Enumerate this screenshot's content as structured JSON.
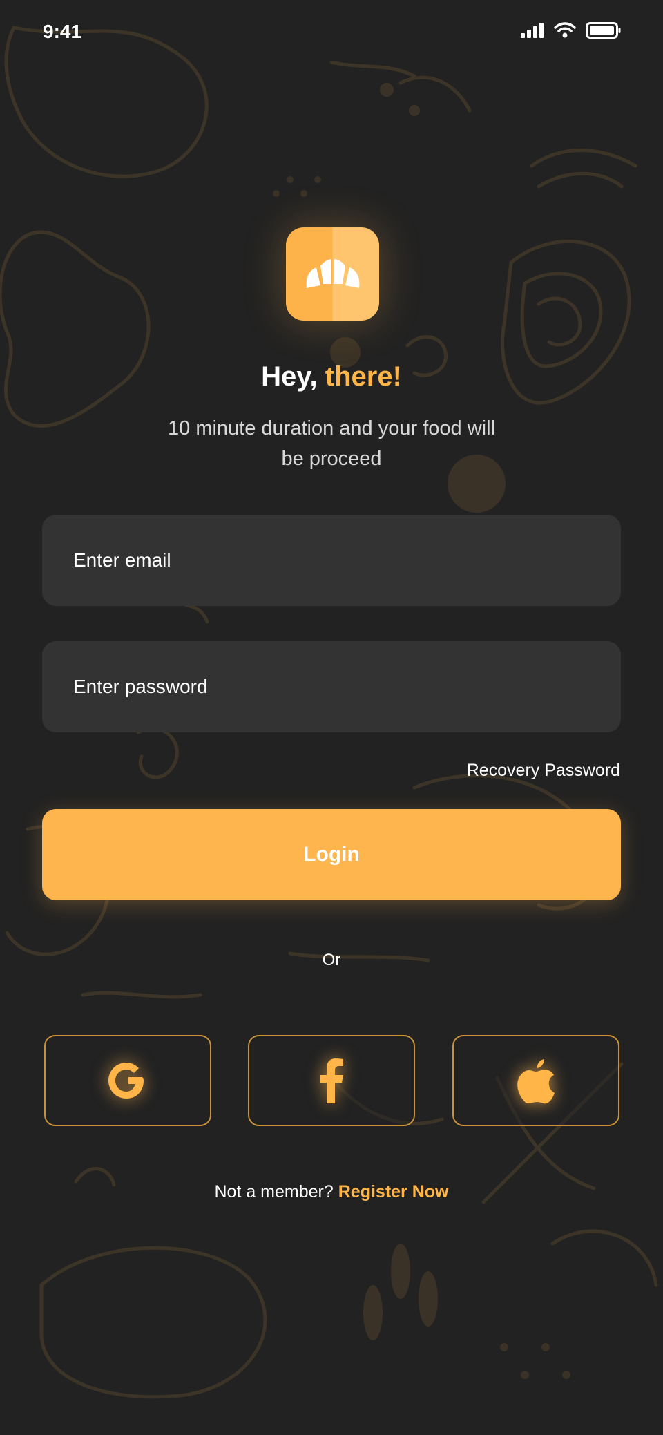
{
  "status_bar": {
    "time": "9:41"
  },
  "header": {
    "greeting": "Hey,",
    "greeting_accent": "there!",
    "subtitle": "10 minute duration and your food will be proceed"
  },
  "form": {
    "email_placeholder": "Enter email",
    "password_placeholder": "Enter password",
    "recovery_label": "Recovery Password",
    "login_label": "Login"
  },
  "divider": {
    "label": "Or"
  },
  "social": [
    {
      "icon": "google-icon"
    },
    {
      "icon": "facebook-icon"
    },
    {
      "icon": "apple-icon"
    }
  ],
  "footer": {
    "prompt": "Not a member?",
    "register_label": "Register Now"
  },
  "colors": {
    "background": "#222222",
    "accent": "#FFB547",
    "field": "#333333"
  }
}
